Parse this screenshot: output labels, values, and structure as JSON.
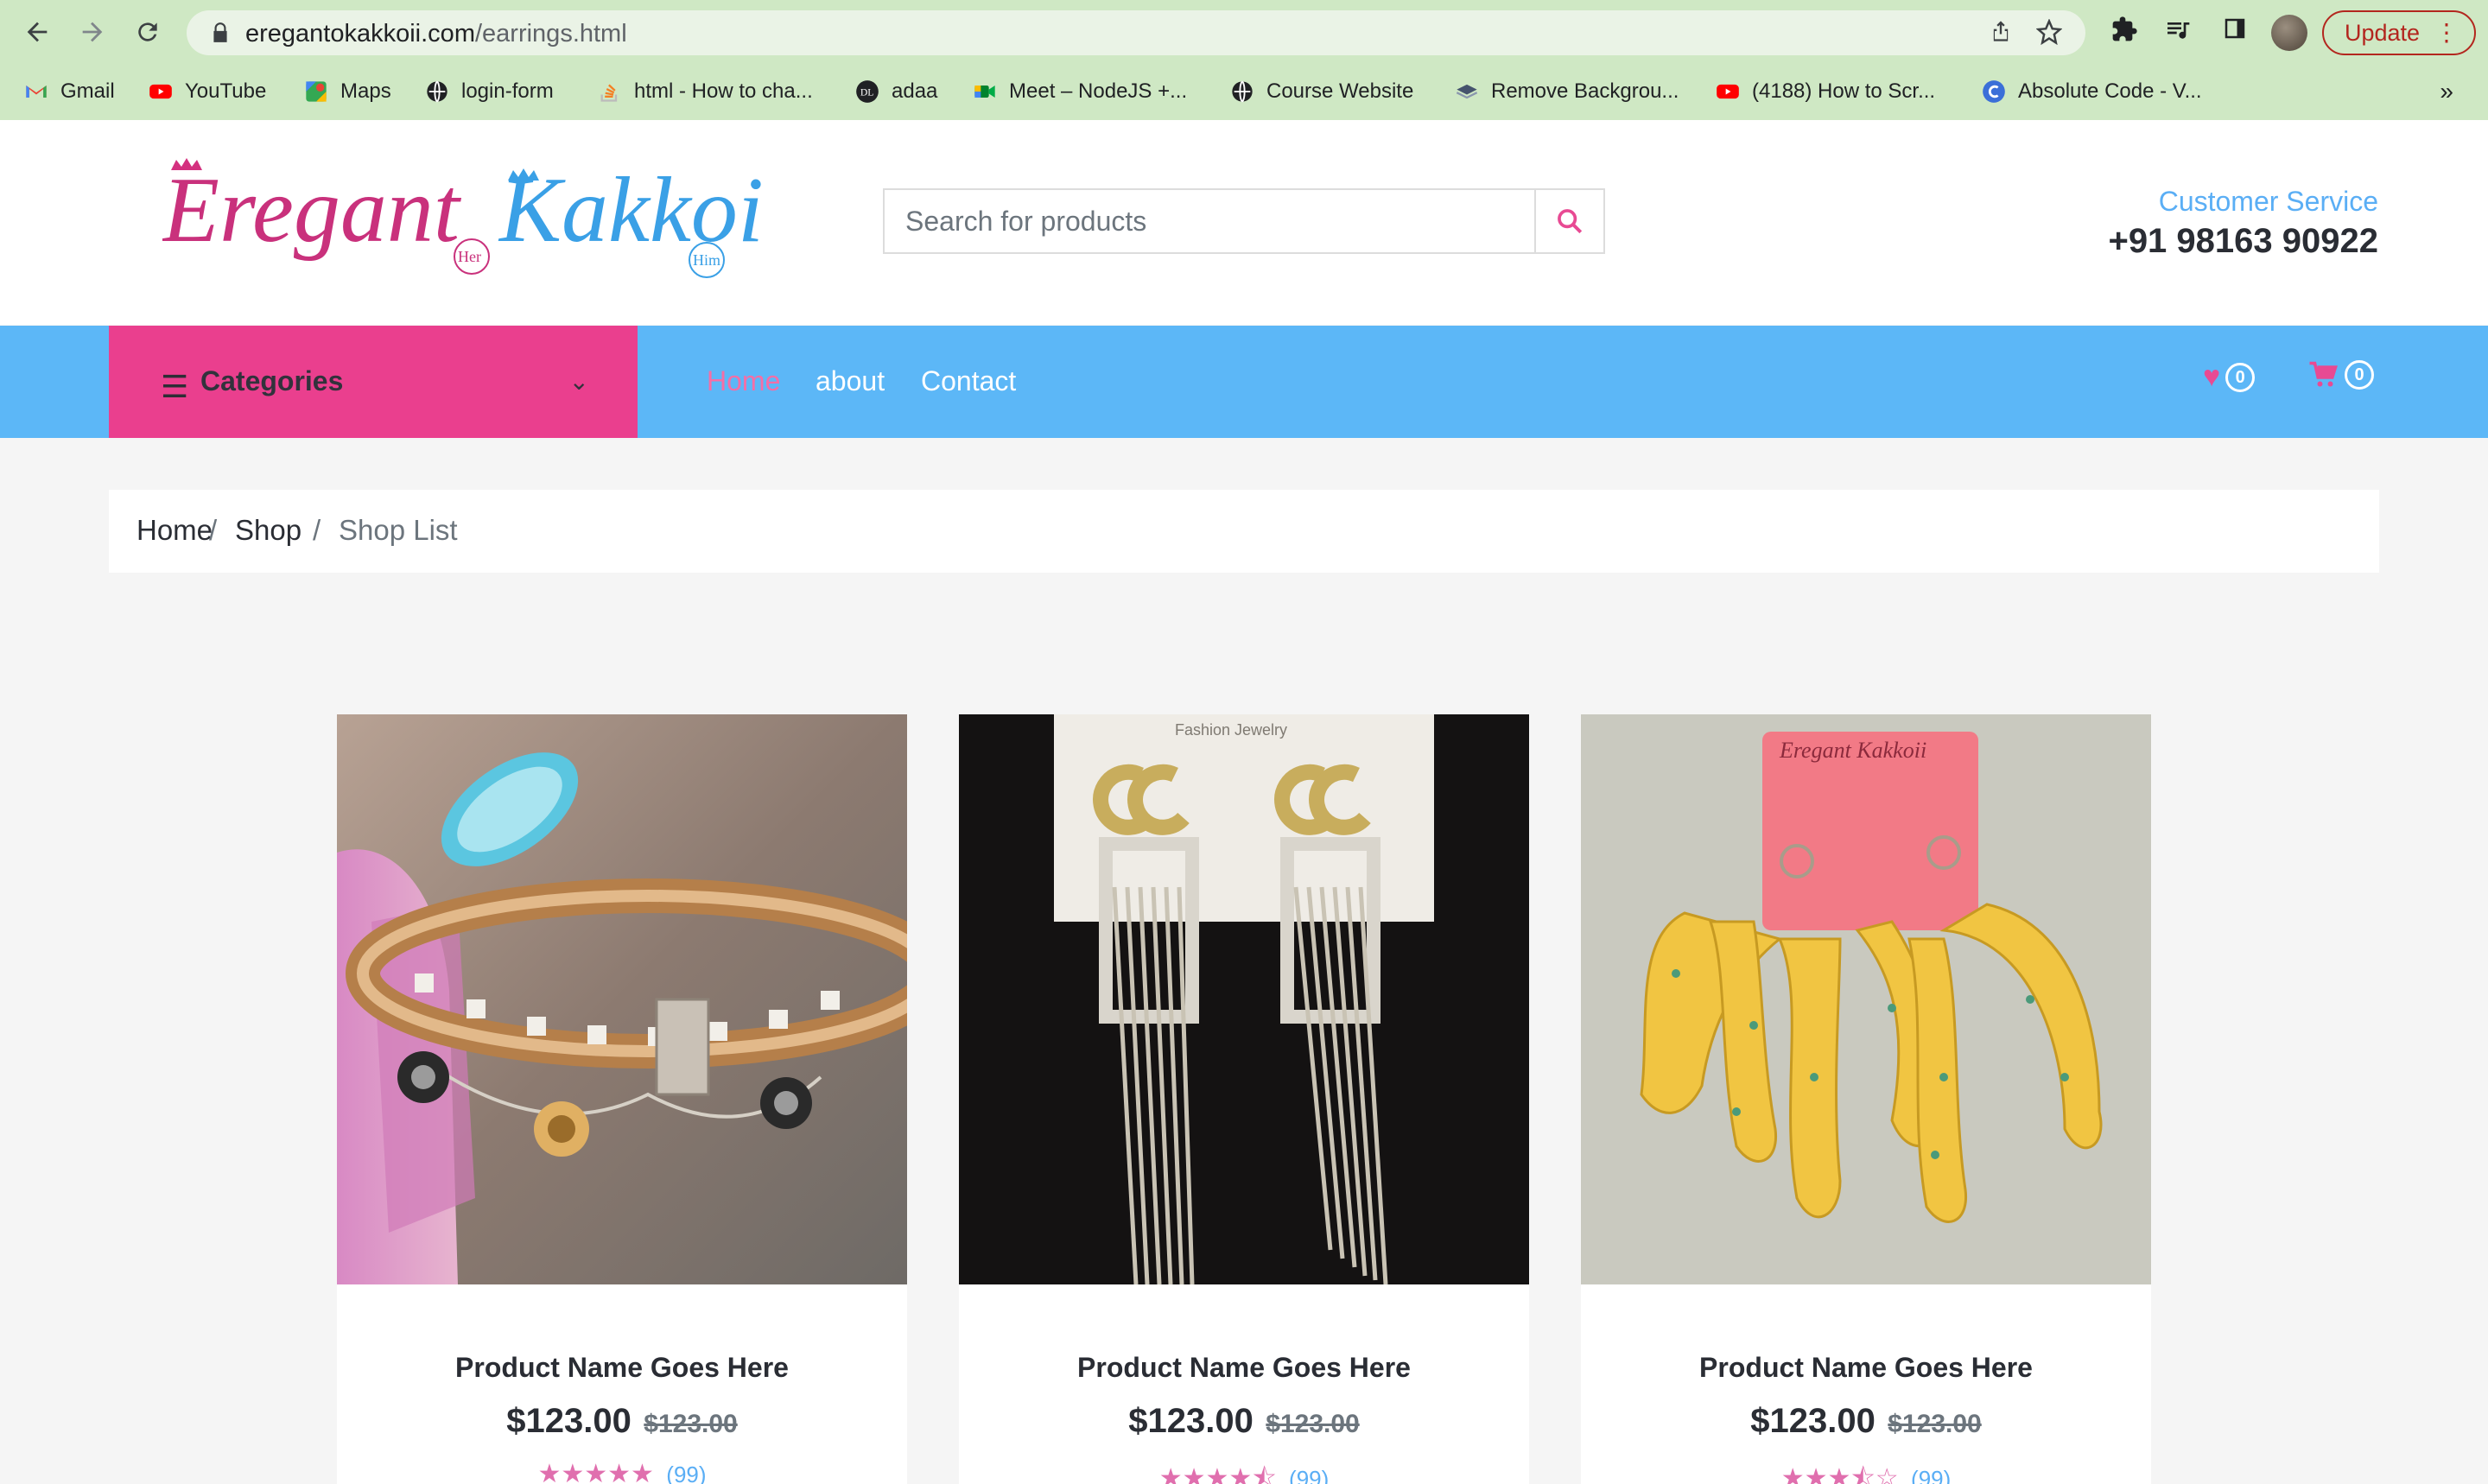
{
  "browser": {
    "url_domain": "eregantokakkoii.com",
    "url_path": "/earrings.html",
    "update_label": "Update",
    "bookmarks": [
      {
        "label": "Gmail",
        "icon": "gmail-icon"
      },
      {
        "label": "YouTube",
        "icon": "youtube-icon"
      },
      {
        "label": "Maps",
        "icon": "maps-icon"
      },
      {
        "label": "login-form",
        "icon": "globe-icon"
      },
      {
        "label": "html - How to cha...",
        "icon": "stackoverflow-icon"
      },
      {
        "label": "adaa",
        "icon": "adaa-icon"
      },
      {
        "label": "Meet – NodeJS +...",
        "icon": "meet-icon"
      },
      {
        "label": "Course Website",
        "icon": "globe-icon"
      },
      {
        "label": "Remove Backgrou...",
        "icon": "removebg-icon"
      },
      {
        "label": "(4188) How to Scr...",
        "icon": "youtube-icon"
      },
      {
        "label": "Absolute Code - V...",
        "icon": "absolute-code-icon"
      }
    ],
    "more": "»"
  },
  "header": {
    "logo_text_left": "Eregant",
    "logo_text_right": "Kakkoii",
    "logo_badge_left": "Her",
    "logo_badge_right": "Him",
    "search_placeholder": "Search for products",
    "customer_service_label": "Customer Service",
    "phone": "+91 98163 90922"
  },
  "nav": {
    "categories_label": "Categories",
    "links": [
      "Home",
      "about",
      "Contact"
    ],
    "wishlist_count": "0",
    "cart_count": "0"
  },
  "breadcrumb": {
    "home": "Home",
    "shop": "Shop",
    "current": "Shop List",
    "sep1": "/",
    "sep2": "/"
  },
  "products": [
    {
      "name": "Product Name Goes Here",
      "price": "$123.00",
      "old_price": "$123.00",
      "rating": 5,
      "reviews": "(99)",
      "stars": "★★★★★"
    },
    {
      "name": "Product Name Goes Here",
      "price": "$123.00",
      "old_price": "$123.00",
      "rating": 4.5,
      "reviews": "(99)",
      "stars": "★★★★⯪"
    },
    {
      "name": "Product Name Goes Here",
      "price": "$123.00",
      "old_price": "$123.00",
      "rating": 3.5,
      "reviews": "(99)",
      "stars": "★★★⯪☆"
    }
  ],
  "colors": {
    "nav_bg": "#5cb7f7",
    "categories_bg": "#ea3f8e",
    "accent_pink": "#e84a93",
    "accent_blue": "#5aaef5"
  }
}
